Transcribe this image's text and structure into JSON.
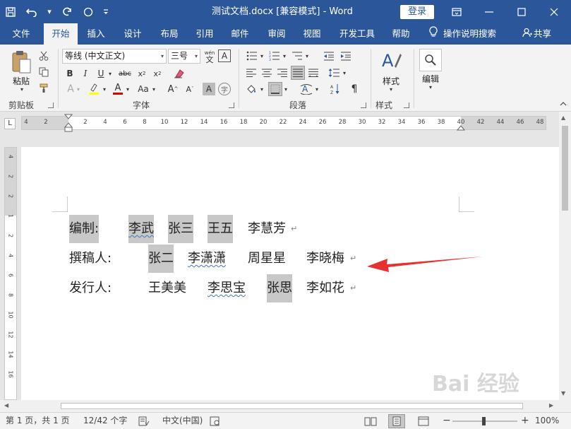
{
  "titlebar": {
    "title": "测试文档.docx [兼容模式]  -  Word",
    "login": "登录",
    "bg_color": "#2b579a"
  },
  "tabs": [
    {
      "label": "文件"
    },
    {
      "label": "开始"
    },
    {
      "label": "插入"
    },
    {
      "label": "设计"
    },
    {
      "label": "布局"
    },
    {
      "label": "引用"
    },
    {
      "label": "邮件"
    },
    {
      "label": "审阅"
    },
    {
      "label": "视图"
    },
    {
      "label": "开发工具"
    },
    {
      "label": "帮助"
    }
  ],
  "tellme": "操作说明搜索",
  "share": "共享",
  "ribbon": {
    "clipboard": {
      "paste": "粘贴",
      "group": "剪贴板"
    },
    "font": {
      "name": "等线 (中文正文)",
      "size": "三号",
      "group": "字体",
      "wen": "wén"
    },
    "paragraph": {
      "group": "段落"
    },
    "styles": {
      "label": "样式",
      "group": "样式"
    },
    "editing": {
      "label": "编辑"
    }
  },
  "ruler": {
    "corner": "L",
    "ticks": [
      "4",
      "2",
      "",
      "2",
      "4",
      "6",
      "8",
      "10",
      "12",
      "14",
      "16",
      "18",
      "20",
      "22",
      "24",
      "26",
      "28",
      "30",
      "32",
      "34",
      "36",
      "38",
      "40",
      "42",
      "44",
      "46",
      "48"
    ],
    "vticks": [
      "4",
      "2",
      "2",
      "1",
      "2",
      "4",
      "6",
      "8",
      "10",
      "12",
      "14",
      "16"
    ]
  },
  "document": {
    "lines": [
      {
        "label": "编制:",
        "names": [
          "李武",
          "张三",
          "王五",
          "李慧芳"
        ]
      },
      {
        "label": "撰稿人:",
        "names": [
          "张二",
          "李潇潇",
          "周星星",
          "李晓梅"
        ]
      },
      {
        "label": "发行人:",
        "names": [
          "王美美",
          "李思宝",
          "张思",
          "李如花"
        ]
      }
    ],
    "para_mark": "↵"
  },
  "statusbar": {
    "page": "第 1 页，共 1 页",
    "words": "12/42 个字",
    "language": "中文(中国)",
    "zoom": "100%",
    "zoom_minus": "−",
    "zoom_plus": "+"
  },
  "annotation": {
    "arrow_color": "#e8312f"
  },
  "watermark": "Bai 经验"
}
